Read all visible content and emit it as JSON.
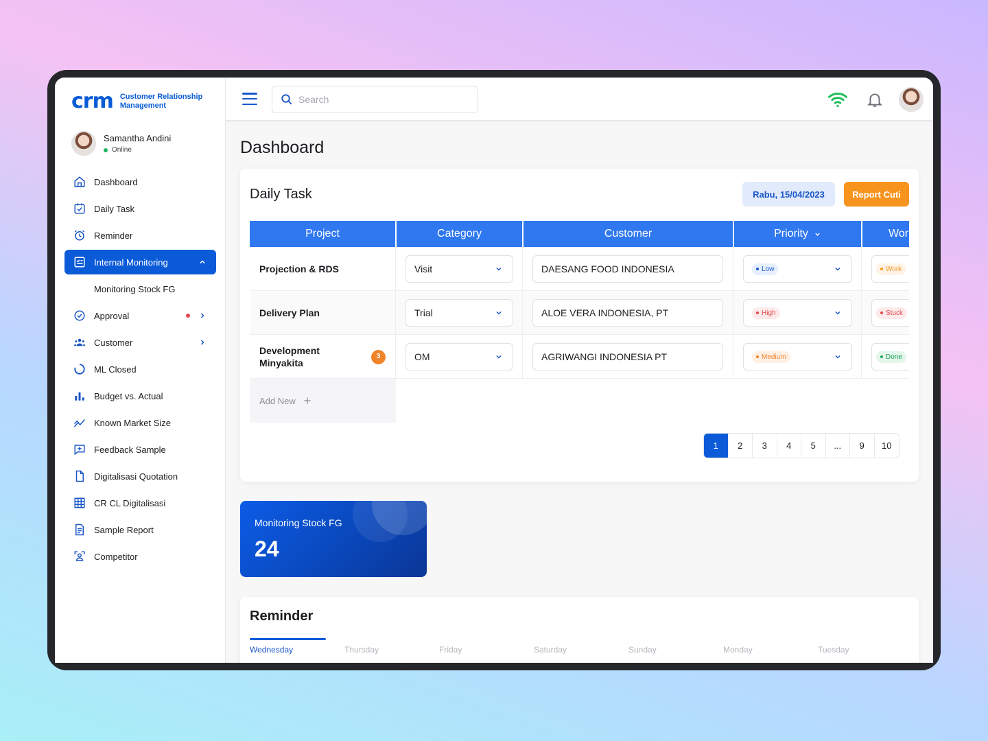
{
  "brand": {
    "logo": "crm",
    "tagline_line1": "Customer Relationship",
    "tagline_line2": "Management"
  },
  "user": {
    "name": "Samantha Andini",
    "status": "Online"
  },
  "sidebar": {
    "items": [
      {
        "label": "Dashboard",
        "icon": "home-icon"
      },
      {
        "label": "Daily Task",
        "icon": "calendar-check-icon"
      },
      {
        "label": "Reminder",
        "icon": "alarm-clock-icon"
      },
      {
        "label": "Internal Monitoring",
        "icon": "monitor-list-icon"
      },
      {
        "label": "Monitoring Stock FG"
      },
      {
        "label": "Approval",
        "icon": "check-circle-icon"
      },
      {
        "label": "Customer",
        "icon": "users-icon"
      },
      {
        "label": "ML Closed",
        "icon": "ring-icon"
      },
      {
        "label": "Budget vs. Actual",
        "icon": "bar-chart-icon"
      },
      {
        "label": "Known Market Size",
        "icon": "trend-line-icon"
      },
      {
        "label": "Feedback Sample",
        "icon": "chat-plus-icon"
      },
      {
        "label": "Digitalisasi Quotation",
        "icon": "document-icon"
      },
      {
        "label": "CR CL Digitalisasi",
        "icon": "grid-table-icon"
      },
      {
        "label": "Sample Report",
        "icon": "report-icon"
      },
      {
        "label": "Competitor",
        "icon": "competitor-icon"
      }
    ]
  },
  "topbar": {
    "search_placeholder": "Search"
  },
  "page": {
    "title": "Dashboard"
  },
  "daily_task": {
    "title": "Daily Task",
    "date": "Rabu, 15/04/2023",
    "report_button": "Report Cuti",
    "columns": [
      "Project",
      "Category",
      "Customer",
      "Priority",
      "Wor"
    ],
    "rows": [
      {
        "project": "Projection & RDS",
        "category": "Visit",
        "customer": "DAESANG FOOD INDONESIA",
        "priority": "Low",
        "work": "Work"
      },
      {
        "project": "Delivery Plan",
        "category": "Trial",
        "customer": "ALOE VERA INDONESIA, PT",
        "priority": "High",
        "work": "Stuck"
      },
      {
        "project": "Development Minyakita",
        "badge": "3",
        "category": "OM",
        "customer": "AGRIWANGI INDONESIA PT",
        "priority": "Medium",
        "work": "Done"
      }
    ],
    "add_new": "Add New",
    "pagination": [
      "1",
      "2",
      "3",
      "4",
      "5",
      "...",
      "9",
      "10"
    ]
  },
  "stock": {
    "label": "Monitoring Stock FG",
    "value": "24"
  },
  "reminder": {
    "title": "Reminder",
    "days": [
      "Wednesday",
      "Thursday",
      "Friday",
      "Saturday",
      "Sunday",
      "Monday",
      "Tuesday"
    ]
  },
  "colors": {
    "primary": "#0b5bd9",
    "header_blue": "#2f78f0",
    "orange": "#f7941d",
    "low": "#1a56c8",
    "high": "#e5484d",
    "medium": "#f0842a",
    "done": "#1fa35a",
    "online": "#22b35e"
  }
}
